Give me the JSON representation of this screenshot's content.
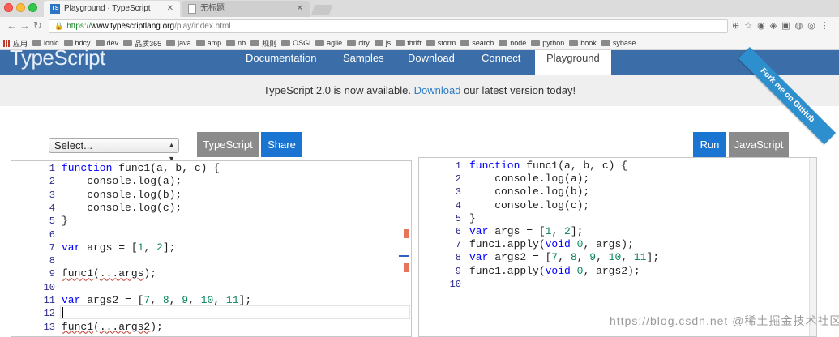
{
  "browser": {
    "tabs": [
      {
        "title": "Playground · TypeScript",
        "active": true,
        "favicon": "ts-icon"
      },
      {
        "title": "无标题",
        "active": false,
        "favicon": "document-icon"
      }
    ],
    "url": {
      "scheme": "https://",
      "host": "www.typescriptlang.org",
      "path": "/play/index.html"
    },
    "bookmarks": [
      "应用",
      "ionic",
      "hdcy",
      "dev",
      "品质365",
      "java",
      "amp",
      "nb",
      "规则",
      "OSGi",
      "aglie",
      "city",
      "js",
      "thrift",
      "storm",
      "search",
      "node",
      "python",
      "book",
      "sybase"
    ]
  },
  "site": {
    "logo": "TypeScript",
    "nav": [
      "Documentation",
      "Samples",
      "Download",
      "Connect",
      "Playground"
    ],
    "ribbon": "Fork me on GitHub",
    "announcement": {
      "before": "TypeScript 2.0 is now available. ",
      "link": "Download",
      "after": " our latest version today!"
    }
  },
  "controls": {
    "select_value": "Select...",
    "typescript_button": "TypeScript",
    "share_button": "Share",
    "run_button": "Run",
    "javascript_button": "JavaScript"
  },
  "editor_left": {
    "lines": [
      {
        "n": "1",
        "code": "function func1(a, b, c) {"
      },
      {
        "n": "2",
        "code": "    console.log(a);"
      },
      {
        "n": "3",
        "code": "    console.log(b);"
      },
      {
        "n": "4",
        "code": "    console.log(c);"
      },
      {
        "n": "5",
        "code": "}"
      },
      {
        "n": "6",
        "code": ""
      },
      {
        "n": "7",
        "code": "var args = [1, 2];"
      },
      {
        "n": "8",
        "code": ""
      },
      {
        "n": "9",
        "code": "func1(...args);"
      },
      {
        "n": "10",
        "code": ""
      },
      {
        "n": "11",
        "code": "var args2 = [7, 8, 9, 10, 11];"
      },
      {
        "n": "12",
        "code": ""
      },
      {
        "n": "13",
        "code": "func1(...args2);"
      }
    ]
  },
  "editor_right": {
    "lines": [
      {
        "n": "1",
        "code": "function func1(a, b, c) {"
      },
      {
        "n": "2",
        "code": "    console.log(a);"
      },
      {
        "n": "3",
        "code": "    console.log(b);"
      },
      {
        "n": "4",
        "code": "    console.log(c);"
      },
      {
        "n": "5",
        "code": "}"
      },
      {
        "n": "6",
        "code": "var args = [1, 2];"
      },
      {
        "n": "7",
        "code": "func1.apply(void 0, args);"
      },
      {
        "n": "8",
        "code": "var args2 = [7, 8, 9, 10, 11];"
      },
      {
        "n": "9",
        "code": "func1.apply(void 0, args2);"
      },
      {
        "n": "10",
        "code": ""
      }
    ]
  },
  "watermark": "https://blog.csdn.net @稀土掘金技术社区",
  "colors": {
    "nav_bg": "#3b6ea8",
    "primary_button": "#1a74d2",
    "secondary_button": "#8b8b8b",
    "keyword": "#0000ff",
    "number": "#098658"
  }
}
